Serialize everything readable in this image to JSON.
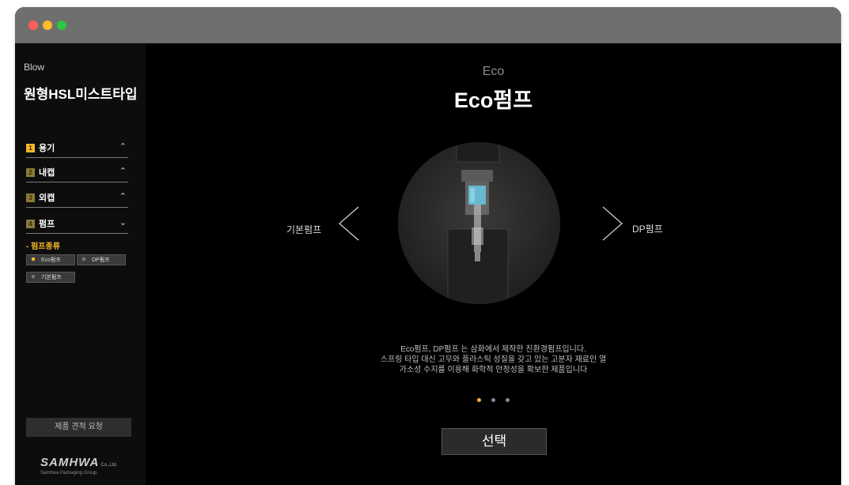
{
  "window": {
    "controls": [
      "close",
      "minimize",
      "maximize"
    ]
  },
  "sidebar": {
    "breadcrumb": "Blow",
    "product_title": "원형HSL미스트타입",
    "steps": [
      {
        "num": "1",
        "label": "용기",
        "chevron": "⌃",
        "color": "#f3b72a"
      },
      {
        "num": "2",
        "label": "내캡",
        "chevron": "⌃",
        "color": "#8a7a3a"
      },
      {
        "num": "3",
        "label": "외캡",
        "chevron": "⌃",
        "color": "#8a7a3a"
      },
      {
        "num": "4",
        "label": "펌프",
        "chevron": "⌄",
        "color": "#8a7a3a"
      }
    ],
    "sub_heading": "- 펌프종류",
    "pump_options": [
      {
        "label": "Eco펌프",
        "selected": true
      },
      {
        "label": "DP펌프",
        "selected": false
      },
      {
        "label": "기본펌프",
        "selected": false
      }
    ],
    "quote_button": "제품 견적 요청",
    "logo": {
      "mark": "SAMHWA",
      "co": "Co.,Ltd.",
      "tagline": "Samhwa Packaging Group."
    }
  },
  "main": {
    "eyebrow": "Eco",
    "title": "Eco펌프",
    "prev_label": "기본펌프",
    "next_label": "DP펌프",
    "description": [
      "Eco펌프,  DP펌프 는 삼화에서 제작한 친환경펌프입니다.",
      "스프링 타입 대신 고무와 플라스틱 성질을 갖고 있는 고분자 재료인 열",
      "가소성 수지를 이용해 화학적 안정성을 확보한 제품입니다"
    ],
    "pager": {
      "count": 3,
      "active": 1
    },
    "select_button": "선택"
  },
  "colors": {
    "accent": "#f3b72a",
    "background": "#000000",
    "sidebar": "#0d0d0d",
    "titlebar": "#6f6f6f"
  },
  "icons": [
    "chevron-up-icon",
    "chevron-down-icon",
    "chevron-left-icon",
    "chevron-right-icon"
  ]
}
